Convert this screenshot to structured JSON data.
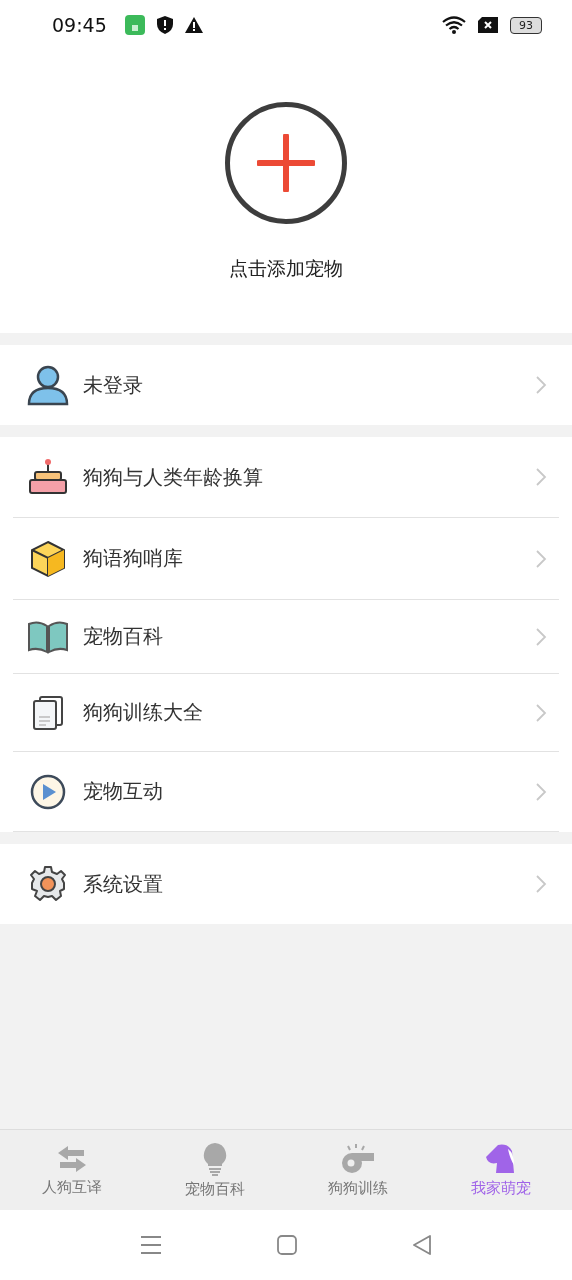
{
  "status_bar": {
    "time": "09:45",
    "battery": "93"
  },
  "add_pet": {
    "label": "点击添加宠物"
  },
  "menu_groups": [
    [
      {
        "kind": "user",
        "label": "未登录"
      }
    ],
    [
      {
        "kind": "cake",
        "label": "狗狗与人类年龄换算"
      },
      {
        "kind": "cube",
        "label": "狗语狗哨库"
      },
      {
        "kind": "book",
        "label": "宠物百科"
      },
      {
        "kind": "document",
        "label": "狗狗训练大全"
      },
      {
        "kind": "play",
        "label": "宠物互动"
      }
    ],
    [
      {
        "kind": "gear",
        "label": "系统设置"
      }
    ]
  ],
  "tab_bar": [
    {
      "kind": "swap",
      "label": "人狗互译",
      "selected": false
    },
    {
      "kind": "bulb",
      "label": "宠物百科",
      "selected": false
    },
    {
      "kind": "whistle",
      "label": "狗狗训练",
      "selected": false
    },
    {
      "kind": "dog",
      "label": "我家萌宠",
      "selected": true
    }
  ]
}
